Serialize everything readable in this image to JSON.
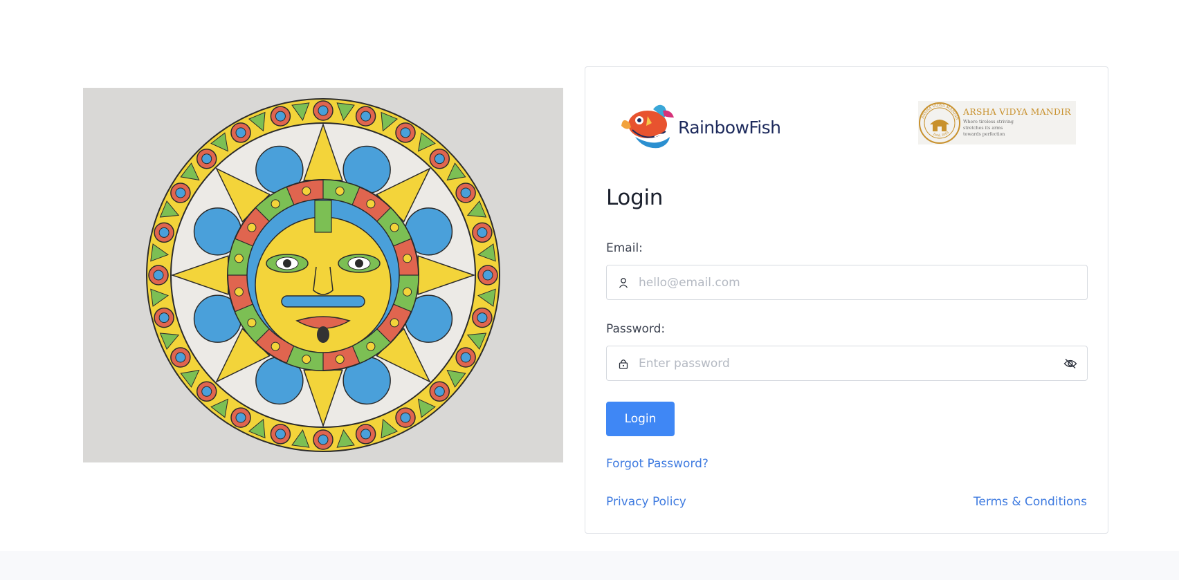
{
  "art": {
    "alt": "sun mandala drawing",
    "colors": {
      "background": "#d9d8d6",
      "yellow": "#f3d43a",
      "red": "#e0654f",
      "blue": "#4aa0da",
      "green": "#7cbf54"
    }
  },
  "logos": {
    "rainbowfish": {
      "name": "RainbowFish"
    },
    "arsha": {
      "name": "ARSHA VIDYA MANDIR",
      "tagline_1": "Where tireless striving",
      "tagline_2": "stretches its arms",
      "tagline_3": "towards perfection",
      "seal_top": "ARSHA VIDYA MANDIR",
      "seal_bottom": "Estd. 2003"
    }
  },
  "login": {
    "title": "Login",
    "email_label": "Email:",
    "email_placeholder": "hello@email.com",
    "email_value": "",
    "password_label": "Password:",
    "password_placeholder": "Enter password",
    "password_value": "",
    "submit_label": "Login",
    "forgot_link": "Forgot Password?",
    "privacy_link": "Privacy Policy",
    "terms_link": "Terms & Conditions"
  },
  "icons": {
    "email_field": "user-icon",
    "password_field": "lock-icon",
    "password_toggle": "eye-off-icon"
  },
  "theme": {
    "accent": "#3f87f5",
    "link": "#3f7be0",
    "brand_navy": "#1d2a5c",
    "seal_gold": "#c8912d"
  }
}
